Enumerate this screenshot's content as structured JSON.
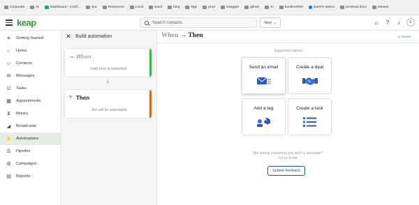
{
  "bookmarks": [
    {
      "label": "Corporate",
      "kind": "folder"
    },
    {
      "label": "IS",
      "kind": "folder"
    },
    {
      "label": "Dashboard - Confl...",
      "kind": "keap"
    },
    {
      "label": "Jira",
      "kind": "folder"
    },
    {
      "label": "Resources",
      "kind": "folder"
    },
    {
      "label": "Local",
      "kind": "folder"
    },
    {
      "label": "Sand",
      "kind": "folder"
    },
    {
      "label": "bing",
      "kind": "folder"
    },
    {
      "label": "stge",
      "kind": "folder"
    },
    {
      "label": "prod",
      "kind": "folder"
    },
    {
      "label": "swagger",
      "kind": "folder"
    },
    {
      "label": "github",
      "kind": "folder"
    },
    {
      "label": "SI",
      "kind": "folder"
    },
    {
      "label": "bookmarklet",
      "kind": "folder"
    },
    {
      "label": "laurel's webex",
      "kind": "globe"
    },
    {
      "label": "techlead docs",
      "kind": "folder"
    },
    {
      "label": "release",
      "kind": "folder"
    }
  ],
  "header": {
    "logo": "keap",
    "search_placeholder": "Search contacts",
    "new_label": "New",
    "avatar_initial": "L"
  },
  "sidebar": {
    "items": [
      {
        "label": "Getting Started",
        "icon": "lightbulb-icon",
        "glyph": "☀",
        "active": false
      },
      {
        "label": "Home",
        "icon": "home-icon",
        "glyph": "⌂",
        "active": false
      },
      {
        "label": "Contacts",
        "icon": "contacts-icon",
        "glyph": "☺",
        "active": false
      },
      {
        "label": "Messages",
        "icon": "messages-icon",
        "glyph": "✉",
        "active": false
      },
      {
        "label": "Tasks",
        "icon": "tasks-icon",
        "glyph": "☑",
        "active": false
      },
      {
        "label": "Appointments",
        "icon": "calendar-icon",
        "glyph": "▦",
        "active": false
      },
      {
        "label": "Money",
        "icon": "money-icon",
        "glyph": "$",
        "active": false
      },
      {
        "label": "Broadcasts",
        "icon": "megaphone-icon",
        "glyph": "◢",
        "active": false
      },
      {
        "label": "Automations",
        "icon": "lightning-icon",
        "glyph": "⚡",
        "active": true
      },
      {
        "label": "Pipeline",
        "icon": "pipeline-icon",
        "glyph": "☰",
        "active": false
      },
      {
        "label": "Campaigns",
        "icon": "campaigns-icon",
        "glyph": "⚙",
        "active": false
      },
      {
        "label": "Reports",
        "icon": "reports-icon",
        "glyph": "▤",
        "active": false
      }
    ]
  },
  "panel": {
    "title": "Build automation",
    "when_card": {
      "title": "When",
      "subtitle": "Lead form is submitted",
      "accent": "#3bb54a"
    },
    "then_card": {
      "title": "Then",
      "subtitle": "...this will be automated.",
      "accent": "#d2691e"
    }
  },
  "main": {
    "heading_when": "When",
    "heading_arrow": "→",
    "heading_then": "Then",
    "saved": "Saved",
    "suggested": "Suggested options",
    "options": [
      {
        "label": "Send an email",
        "icon": "email-icon",
        "selected": true
      },
      {
        "label": "Create a deal",
        "icon": "handshake-icon",
        "selected": false
      },
      {
        "label": "Add a tag",
        "icon": "tag-icon",
        "selected": false
      },
      {
        "label": "Create a task",
        "icon": "task-list-icon",
        "selected": false
      }
    ],
    "not_seeing_line1": "Not seeing something you wish to automate?",
    "not_seeing_line2": "Let us know!",
    "feedback_label": "Submit feedback"
  },
  "colors": {
    "brand": "#2a9d3a",
    "primary": "#1b4fa8",
    "active_nav": "#e5efe0"
  }
}
